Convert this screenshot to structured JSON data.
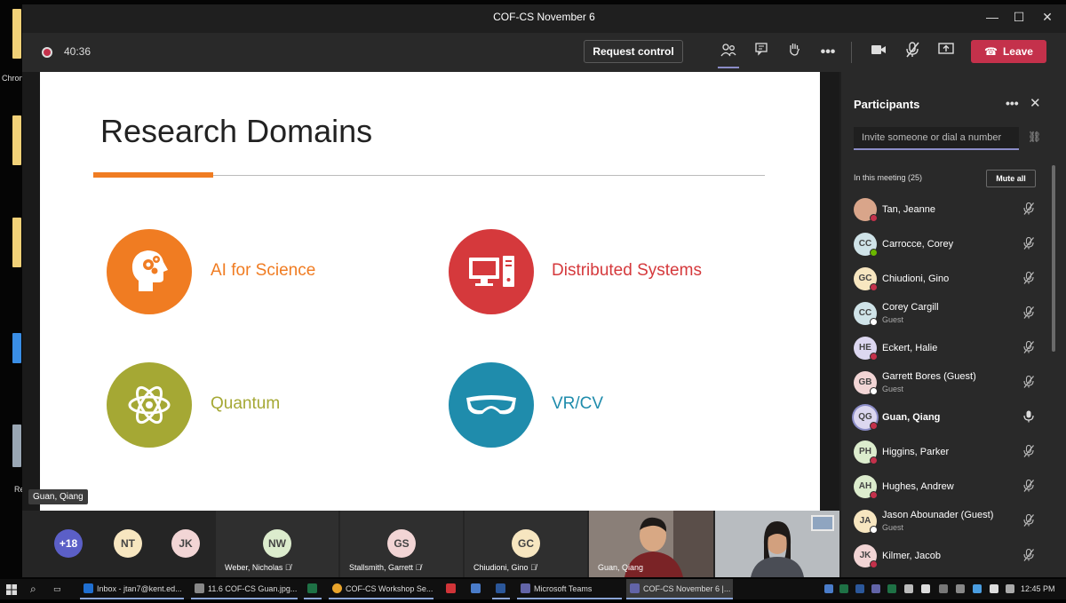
{
  "desktop": {
    "partial_labels": [
      "Chron",
      "Re"
    ]
  },
  "window": {
    "title": "COF-CS November 6",
    "controls": [
      "—",
      "☐",
      "✕"
    ]
  },
  "toolbar": {
    "timer": "40:36",
    "request_control": "Request control",
    "leave": "Leave"
  },
  "slide": {
    "title": "Research Domains",
    "domains": [
      {
        "label": "AI for Science",
        "color": "#f07c22",
        "icon": "head-gears-icon"
      },
      {
        "label": "Distributed Systems",
        "color": "#d5393c",
        "icon": "computer-icon"
      },
      {
        "label": "Quantum",
        "color": "#a5a834",
        "icon": "atom-icon"
      },
      {
        "label": "VR/CV",
        "color": "#1f8cac",
        "icon": "vr-headset-icon"
      }
    ]
  },
  "stage": {
    "speaker_name": "Guan, Qiang"
  },
  "participants": {
    "title": "Participants",
    "invite_placeholder": "Invite someone or dial a number",
    "meeting_label": "In this meeting (25)",
    "mute_all": "Mute all",
    "list": [
      {
        "initials": "",
        "name": "Tan, Jeanne",
        "role": "",
        "avatar_bg": "#d9a58a",
        "status": "#c4314b",
        "bold": false,
        "mic": "muted"
      },
      {
        "initials": "CC",
        "name": "Carrocce, Corey",
        "role": "",
        "avatar_bg": "#cfe3e8",
        "status": "#6bb700",
        "bold": false,
        "mic": "muted"
      },
      {
        "initials": "GC",
        "name": "Chiudioni, Gino",
        "role": "",
        "avatar_bg": "#f7e6c0",
        "status": "#c4314b",
        "bold": false,
        "mic": "muted"
      },
      {
        "initials": "CC",
        "name": "Corey Cargill",
        "role": "Guest",
        "avatar_bg": "#cfe3e8",
        "status": "#ffffff",
        "bold": false,
        "mic": "muted"
      },
      {
        "initials": "HE",
        "name": "Eckert, Halie",
        "role": "",
        "avatar_bg": "#dcd7f0",
        "status": "#c4314b",
        "bold": false,
        "mic": "muted"
      },
      {
        "initials": "GB",
        "name": "Garrett Bores (Guest)",
        "role": "Guest",
        "avatar_bg": "#f2d5d5",
        "status": "#ffffff",
        "bold": false,
        "mic": "muted"
      },
      {
        "initials": "QG",
        "name": "Guan, Qiang",
        "role": "",
        "avatar_bg": "#dcd7f0",
        "status": "#c4314b",
        "bold": true,
        "mic": "on"
      },
      {
        "initials": "PH",
        "name": "Higgins, Parker",
        "role": "",
        "avatar_bg": "#dceccd",
        "status": "#c4314b",
        "bold": false,
        "mic": "muted"
      },
      {
        "initials": "AH",
        "name": "Hughes, Andrew",
        "role": "",
        "avatar_bg": "#dceccd",
        "status": "#c4314b",
        "bold": false,
        "mic": "muted"
      },
      {
        "initials": "JA",
        "name": "Jason Abounader (Guest)",
        "role": "Guest",
        "avatar_bg": "#f7e6c0",
        "status": "#ffffff",
        "bold": false,
        "mic": "muted"
      },
      {
        "initials": "JK",
        "name": "Kilmer, Jacob",
        "role": "",
        "avatar_bg": "#f2d5d5",
        "status": "#c4314b",
        "bold": false,
        "mic": "muted"
      }
    ]
  },
  "gallery": {
    "overflow": "+18",
    "avatars": [
      {
        "initials": "NT",
        "bg": "#f7e6c0",
        "name": ""
      },
      {
        "initials": "JK",
        "bg": "#f2d5d5",
        "name": ""
      },
      {
        "initials": "NW",
        "bg": "#dceccd",
        "name": "Weber, Nicholas"
      },
      {
        "initials": "GS",
        "bg": "#f2d5d5",
        "name": "Stallsmith, Garrett"
      },
      {
        "initials": "GC",
        "bg": "#f7e6c0",
        "name": "Chiudioni, Gino"
      }
    ],
    "video_name": "Guan, Qiang"
  },
  "taskbar": {
    "items": [
      {
        "label": "Inbox - jtan7@kent.ed...",
        "color": "#1f6fd1"
      },
      {
        "label": "11.6 COF-CS Guan.jpg...",
        "color": "#888888"
      },
      {
        "label": "",
        "color": "#1e7145"
      },
      {
        "label": "COF-CS Workshop Se...",
        "color": "#e9a42b"
      },
      {
        "label": "",
        "color": "#d13438"
      },
      {
        "label": "",
        "color": "#4a7cc9"
      },
      {
        "label": "",
        "color": "#2b579a"
      },
      {
        "label": "Microsoft Teams",
        "color": "#6264a7"
      },
      {
        "label": "COF-CS November 6 |...",
        "color": "#6264a7"
      }
    ],
    "clock": "12:45 PM"
  }
}
